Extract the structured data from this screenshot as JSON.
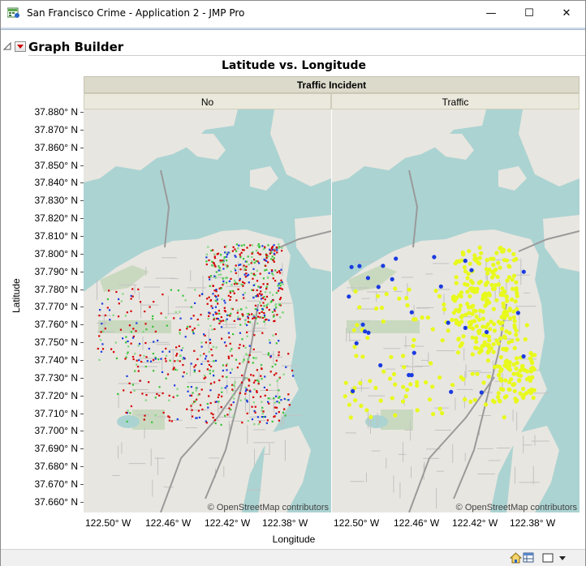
{
  "window": {
    "title": "San Francisco Crime - Application 2 - JMP Pro",
    "minimize_glyph": "—",
    "maximize_glyph": "☐",
    "close_glyph": "✕"
  },
  "outline": {
    "title": "Graph Builder"
  },
  "chart_data": {
    "type": "scatter",
    "title": "Latitude vs. Longitude",
    "xlabel": "Longitude",
    "ylabel": "Latitude",
    "group_by": "Traffic Incident",
    "panels": [
      "No",
      "Traffic"
    ],
    "y_ticks": [
      "37.880° N",
      "37.870° N",
      "37.860° N",
      "37.850° N",
      "37.840° N",
      "37.830° N",
      "37.820° N",
      "37.810° N",
      "37.800° N",
      "37.790° N",
      "37.780° N",
      "37.770° N",
      "37.760° N",
      "37.750° N",
      "37.740° N",
      "37.730° N",
      "37.720° N",
      "37.710° N",
      "37.700° N",
      "37.690° N",
      "37.680° N",
      "37.670° N",
      "37.660° N"
    ],
    "x_ticks": [
      "122.50° W",
      "122.46° W",
      "122.42° W",
      "122.38° W"
    ],
    "ylim": [
      37.66,
      37.88
    ],
    "xlim": [
      -122.52,
      -122.355
    ],
    "attribution": "© OpenStreetMap contributors",
    "colors": {
      "water": "#abd3d2",
      "land": "#e8e6e0",
      "point_red": "#d40000",
      "point_blue": "#1a3be0",
      "point_green": "#3ac23a",
      "point_yellow": "#e8f91c",
      "header_bg": "#dcdacb"
    }
  },
  "statusbar": {
    "home_icon": "home-icon",
    "table_icon": "data-table-icon",
    "window_icon": "window-list-icon",
    "dropdown_icon": "dropdown-arrow-icon"
  }
}
